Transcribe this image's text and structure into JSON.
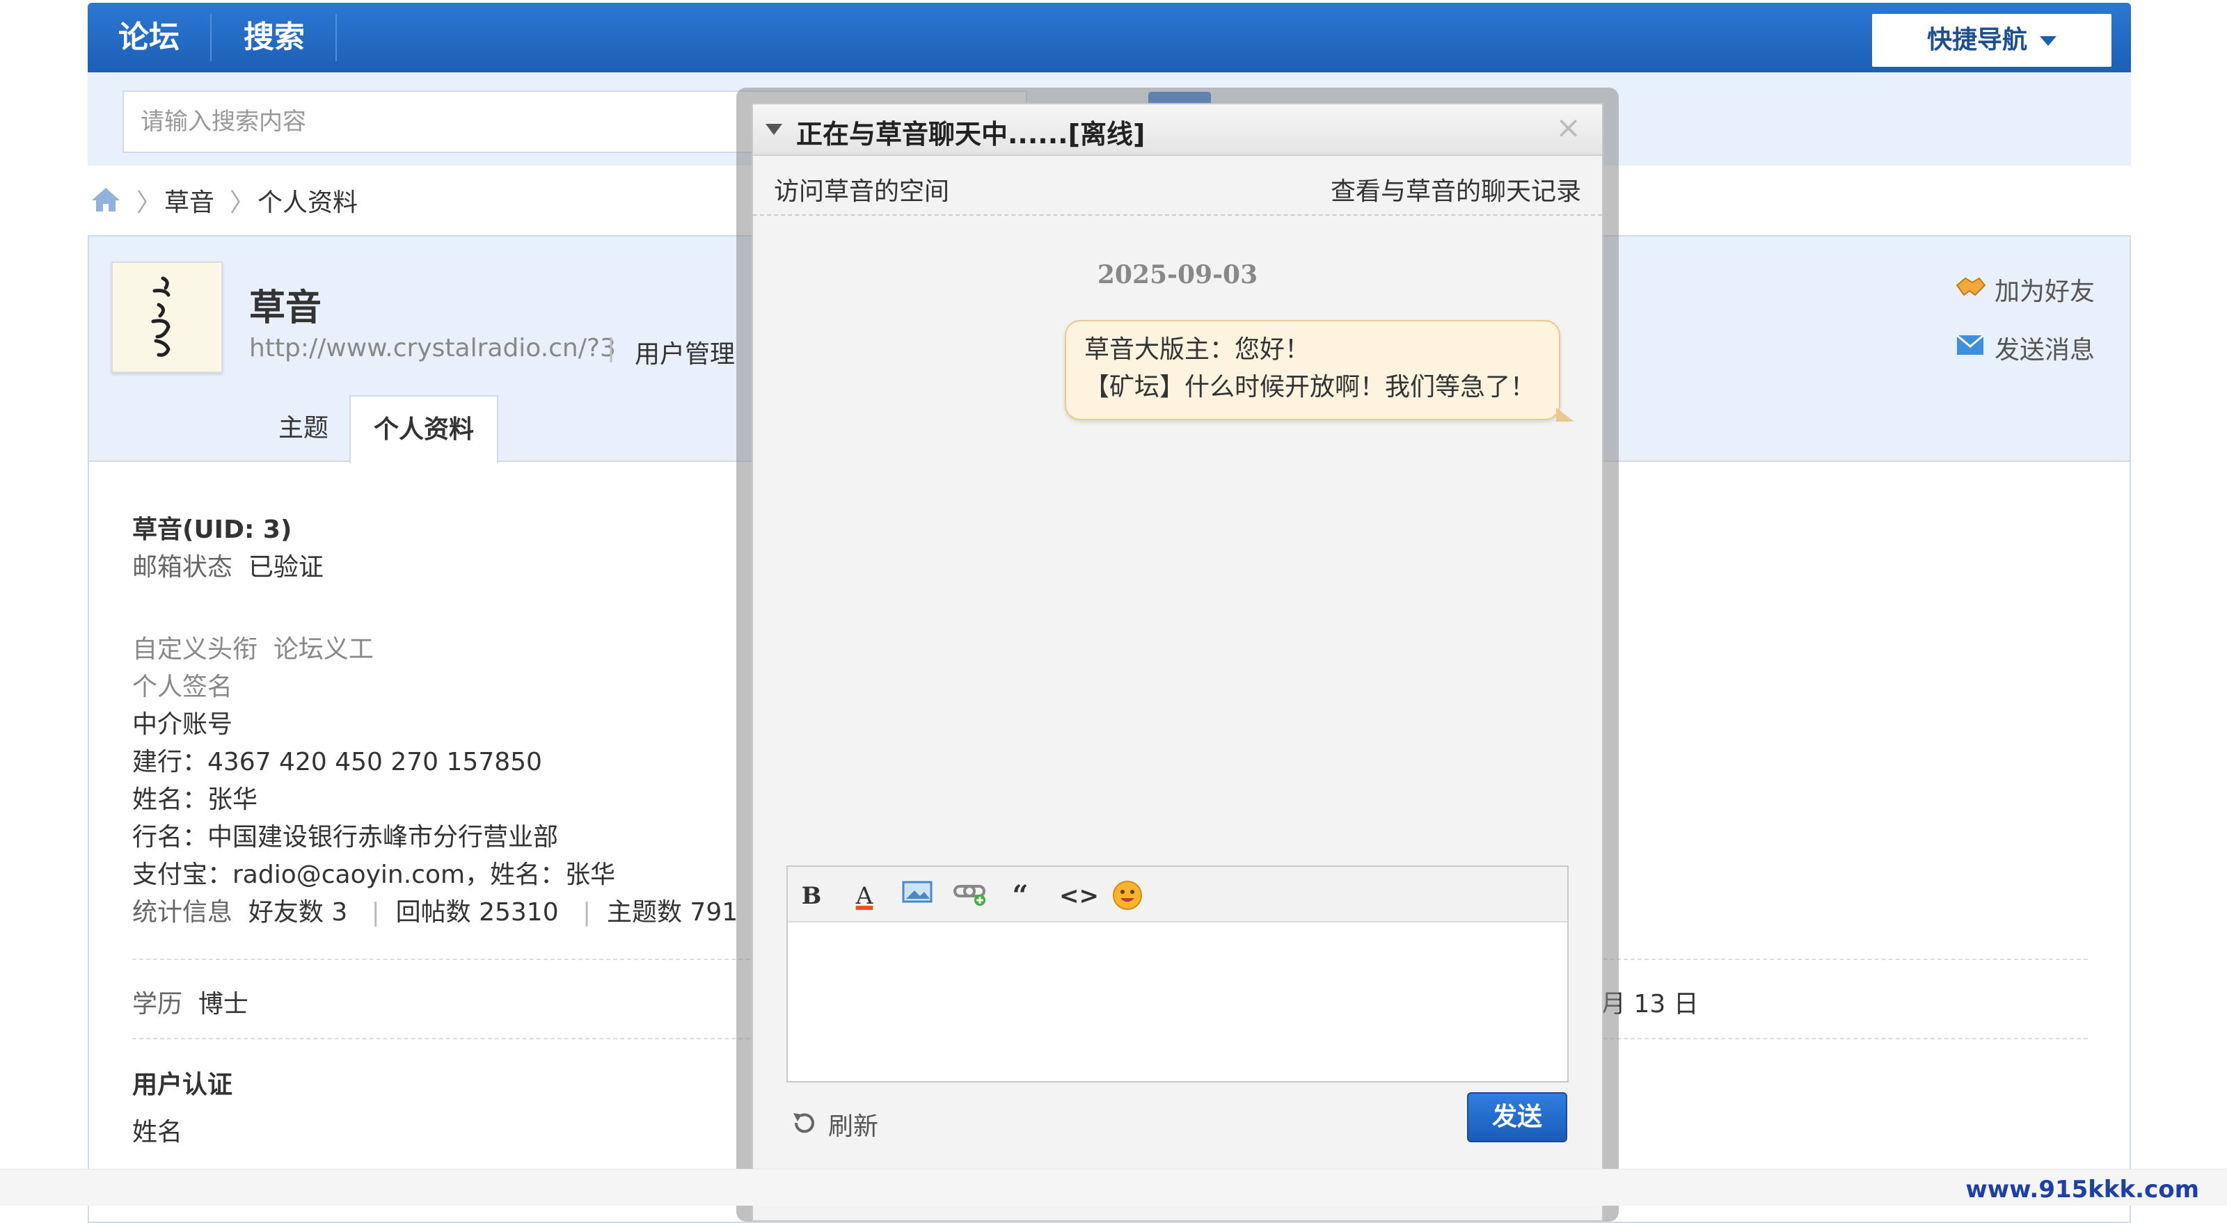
{
  "topnav": {
    "forum": "论坛",
    "search": "搜索",
    "quick_nav": "快捷导航"
  },
  "search": {
    "placeholder": "请输入搜索内容"
  },
  "breadcrumb": {
    "user": "草音",
    "page": "个人资料"
  },
  "profile": {
    "name": "草音",
    "url": "http://www.crystalradio.cn/?3",
    "pipe": "|",
    "manage": "用户管理",
    "tabs": {
      "topics": "主题",
      "profile": "个人资料"
    },
    "actions": {
      "add_friend": "加为好友",
      "send_message": "发送消息"
    },
    "uid_line": "草音(UID: 3)",
    "email_label": "邮箱状态",
    "email_value": "已验证",
    "custom_title_label": "自定义头衔",
    "custom_title_value": "论坛义工",
    "signature_label": "个人签名",
    "sig_lines": [
      "中介账号",
      "建行：4367 420 450 270 157850",
      "姓名：张华",
      "行名：中国建设银行赤峰市分行营业部",
      "支付宝：radio@caoyin.com，姓名：张华"
    ],
    "stats_label": "统计信息",
    "stats_friends": "好友数 3",
    "stats_replies": "回帖数 25310",
    "stats_topics": "主题数 791",
    "stats_sep": "|",
    "edu_label": "学历",
    "edu_value": "博士",
    "date_partial": "月 13 日",
    "cert_heading": "用户认证",
    "cert_name": "姓名"
  },
  "chat": {
    "title": "正在与草音聊天中......[离线]",
    "close": "×",
    "visit_space": "访问草音的空间",
    "view_history": "查看与草音的聊天记录",
    "date": "2025-09-03",
    "message_line1": "草音大版主：您好！",
    "message_line2": "【矿坛】什么时候开放啊！我们等急了！",
    "toolbar": {
      "bold": "B",
      "color": "A",
      "quote": "“",
      "code": "<>"
    },
    "refresh": "刷新",
    "send": "发送"
  },
  "watermark": "www.915kkk.com",
  "colors": {
    "nav_blue": "#1d5fb5",
    "light_blue": "#e8f1fb",
    "bubble_bg": "#fdf3df"
  }
}
